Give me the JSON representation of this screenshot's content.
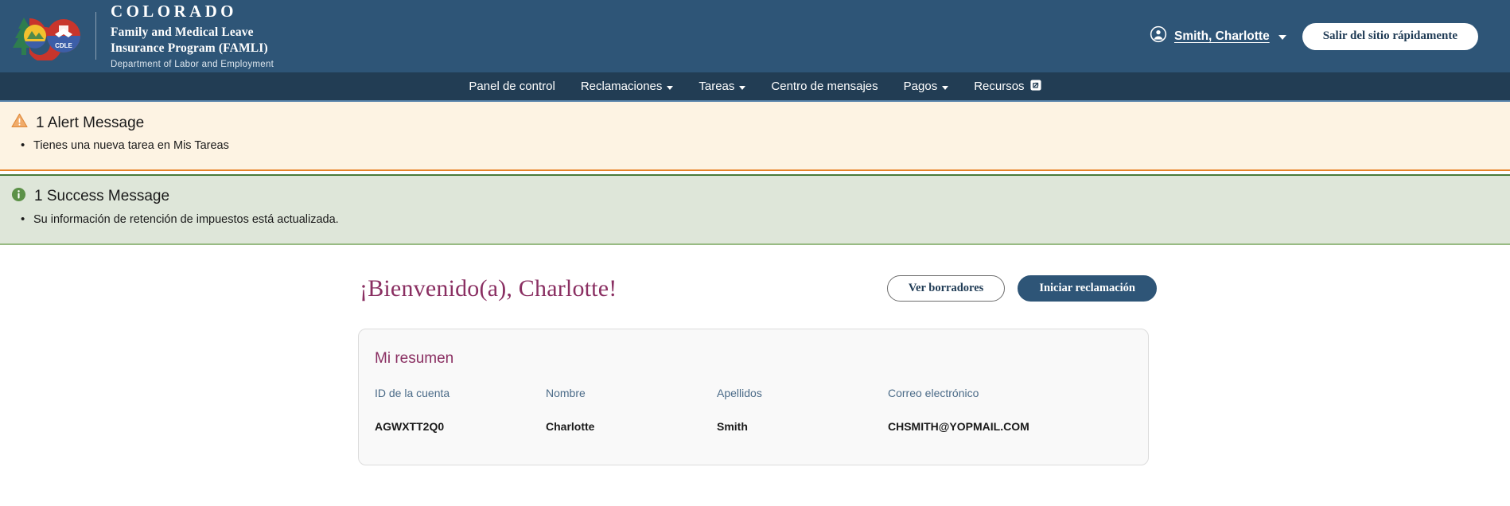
{
  "header": {
    "logo_icon": "colorado-cdle-logo",
    "brand_colorado": "COLORADO",
    "brand_program_line1": "Family and Medical Leave",
    "brand_program_line2": "Insurance Program (FAMLI)",
    "brand_dept": "Department of Labor and Employment",
    "user_icon": "user-circle-icon",
    "user_name": "Smith, Charlotte",
    "user_caret_icon": "chevron-down-icon",
    "exit_button_label": "Salir del sitio rápidamente"
  },
  "nav": {
    "items": [
      {
        "label": "Panel de control",
        "has_caret": false,
        "external": false
      },
      {
        "label": "Reclamaciones",
        "has_caret": true,
        "external": false
      },
      {
        "label": "Tareas",
        "has_caret": true,
        "external": false
      },
      {
        "label": "Centro de mensajes",
        "has_caret": false,
        "external": false
      },
      {
        "label": "Pagos",
        "has_caret": true,
        "external": false
      },
      {
        "label": "Recursos",
        "has_caret": false,
        "external": true
      }
    ]
  },
  "alert_banner": {
    "icon": "warning-triangle-icon",
    "title": "1 Alert Message",
    "messages": [
      "Tienes una nueva tarea en Mis Tareas"
    ]
  },
  "success_banner": {
    "icon": "info-circle-icon",
    "title": "1 Success Message",
    "messages": [
      "Su información de retención de impuestos está actualizada."
    ]
  },
  "main": {
    "welcome_title": "¡Bienvenido(a), Charlotte!",
    "drafts_button_label": "Ver borradores",
    "start_claim_button_label": "Iniciar reclamación",
    "summary": {
      "card_title": "Mi resumen",
      "columns": [
        "ID de la cuenta",
        "Nombre",
        "Apellidos",
        "Correo electrónico"
      ],
      "row": [
        "AGWXTT2Q0",
        "Charlotte",
        "Smith",
        "CHSMITH@YOPMAIL.COM"
      ]
    }
  },
  "colors": {
    "header_blue": "#2e5577",
    "nav_blue": "#223d54",
    "nav_accent": "#5b86ad",
    "alert_bg": "#fdf3e3",
    "alert_border": "#e8842b",
    "success_bg": "#dee6d9",
    "success_border": "#4a7a3a",
    "heading_purple": "#8a2f62",
    "card_bg": "#f9f9f9",
    "label_blue": "#4b6b88"
  }
}
